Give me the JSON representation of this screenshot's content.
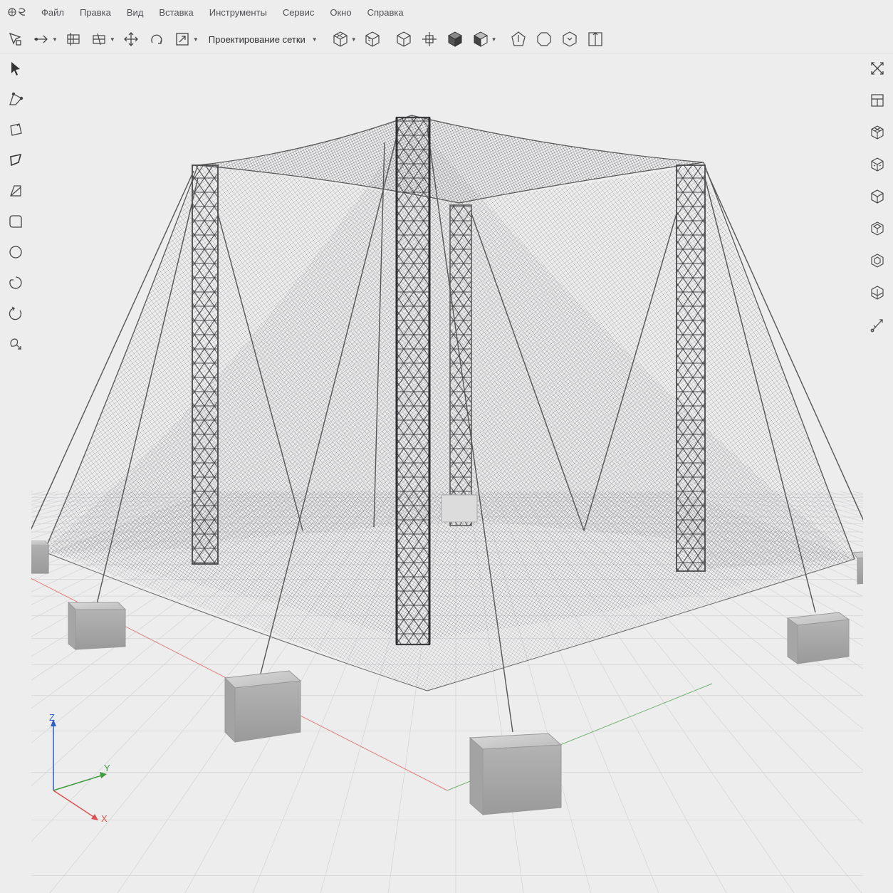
{
  "menu": {
    "items": [
      "Файл",
      "Правка",
      "Вид",
      "Вставка",
      "Инструменты",
      "Сервис",
      "Окно",
      "Справка"
    ]
  },
  "toolbar": {
    "mode_label": "Проектирование сетки",
    "icons": [
      "select-arrow-icon",
      "arrow-direction-icon",
      "mesh-edit-icon",
      "mesh-split-icon",
      "move-icon",
      "rotate-icon",
      "scale-icon",
      "wire-cube-icon",
      "solid-cube-icon",
      "cube-outline-icon",
      "crosshair-icon",
      "filled-cube-icon",
      "half-cube-icon",
      "pentagon-icon",
      "polygon-icon",
      "hexagon-icon",
      "frame-icon"
    ]
  },
  "left_tools": [
    "pointer-icon",
    "node-edit-icon",
    "face-icon",
    "surface-icon",
    "plane-icon",
    "rounded-square-icon",
    "circle-icon",
    "open-circle-icon",
    "spin-icon",
    "lasso-icon"
  ],
  "right_tools": [
    "fit-view-icon",
    "grid-view-icon",
    "isometric-icon",
    "cube-view-icon",
    "cube-front-icon",
    "cube-solid-icon",
    "hex-cube-icon",
    "plane-cube-icon",
    "measure-icon"
  ],
  "axes": {
    "x": "X",
    "y": "Y",
    "z": "Z"
  },
  "colors": {
    "background": "#ededee",
    "x_axis": "#d9534f",
    "y_axis": "#3f9b3f",
    "z_axis": "#2f5fc4"
  }
}
